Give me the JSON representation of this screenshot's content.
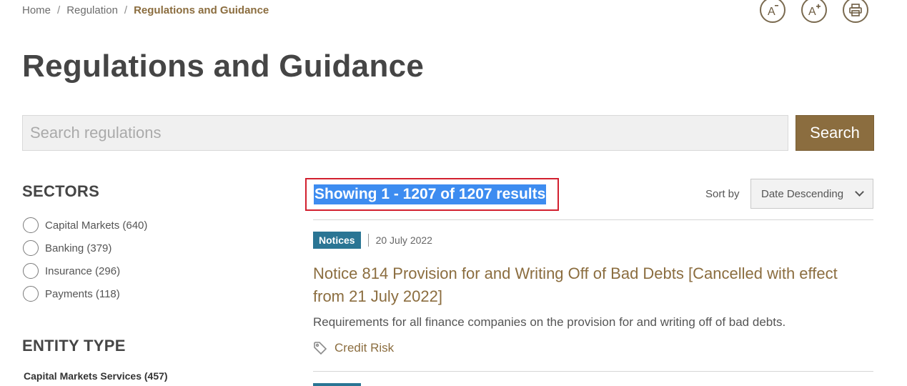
{
  "breadcrumb": {
    "items": [
      "Home",
      "Regulation",
      "Regulations and Guidance"
    ],
    "separator": "/"
  },
  "tools": {
    "decrease_font_icon": "A-",
    "increase_font_icon": "A+",
    "print_icon": "printer"
  },
  "page": {
    "title": "Regulations and Guidance"
  },
  "search": {
    "placeholder": "Search regulations",
    "value": "",
    "button_label": "Search"
  },
  "sidebar": {
    "sectors_heading": "SECTORS",
    "sectors": [
      {
        "label": "Capital Markets (640)"
      },
      {
        "label": "Banking (379)"
      },
      {
        "label": "Insurance (296)"
      },
      {
        "label": "Payments (118)"
      }
    ],
    "entity_heading": "ENTITY TYPE",
    "entity_items": [
      {
        "label": "Capital Markets Services (457)"
      }
    ]
  },
  "results": {
    "summary": "Showing 1 - 1207 of 1207 results",
    "sort_label": "Sort by",
    "sort_value": "Date Descending",
    "items": [
      {
        "type": "Notices",
        "date": "20 July 2022",
        "title": "Notice 814 Provision for and Writing Off of Bad Debts [Cancelled with effect from 21 July 2022]",
        "description": "Requirements for all finance companies on the provision for and writing off of bad debts.",
        "tag": "Credit Risk"
      }
    ]
  },
  "colors": {
    "brand": "#8b6d3f",
    "badge": "#2a7594",
    "highlight": "#3d8cf0",
    "annotation_border": "#d2202f"
  }
}
